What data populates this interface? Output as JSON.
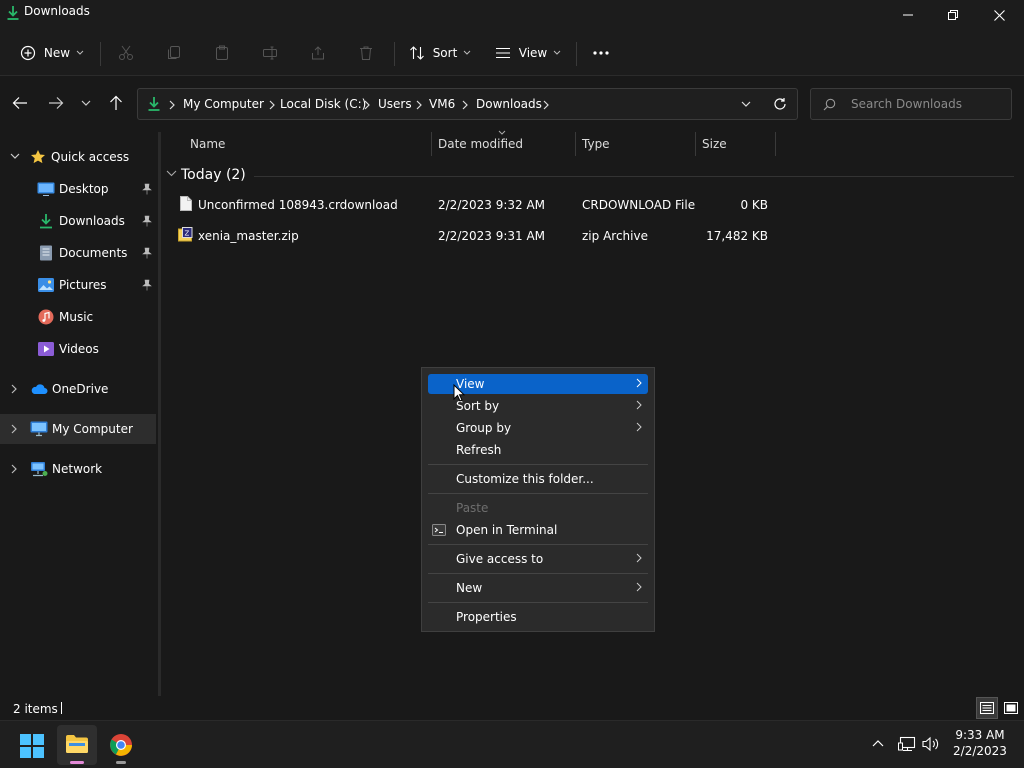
{
  "window": {
    "title": "Downloads",
    "controls": [
      "minimize-icon",
      "restore-icon",
      "close-icon"
    ]
  },
  "toolbar": {
    "new_label": "New",
    "sort_label": "Sort",
    "view_label": "View",
    "icons": [
      "cut-icon",
      "copy-icon",
      "paste-icon",
      "rename-icon",
      "share-icon",
      "delete-icon",
      "more-icon"
    ]
  },
  "address": {
    "breadcrumbs": [
      "My Computer",
      "Local Disk (C:)",
      "Users",
      "VM6",
      "Downloads"
    ],
    "search_placeholder": "Search Downloads"
  },
  "nav": {
    "quick_access": "Quick access",
    "items": [
      {
        "label": "Desktop",
        "icon": "desktop-icon",
        "pinned": true
      },
      {
        "label": "Downloads",
        "icon": "download-icon",
        "pinned": true
      },
      {
        "label": "Documents",
        "icon": "documents-icon",
        "pinned": true
      },
      {
        "label": "Pictures",
        "icon": "pictures-icon",
        "pinned": true
      },
      {
        "label": "Music",
        "icon": "music-icon",
        "pinned": false
      },
      {
        "label": "Videos",
        "icon": "videos-icon",
        "pinned": false
      }
    ],
    "onedrive": "OneDrive",
    "my_computer": "My Computer",
    "network": "Network"
  },
  "files": {
    "columns": [
      "Name",
      "Date modified",
      "Type",
      "Size"
    ],
    "group_label": "Today (2)",
    "rows": [
      {
        "name": "Unconfirmed 108943.crdownload",
        "date": "2/2/2023 9:32 AM",
        "type": "CRDOWNLOAD File",
        "size": "0 KB"
      },
      {
        "name": "xenia_master.zip",
        "date": "2/2/2023 9:31 AM",
        "type": "zip Archive",
        "size": "17,482 KB"
      }
    ]
  },
  "context_menu": {
    "items": [
      {
        "label": "View",
        "submenu": true,
        "highlighted": true
      },
      {
        "label": "Sort by",
        "submenu": true
      },
      {
        "label": "Group by",
        "submenu": true
      },
      {
        "label": "Refresh",
        "submenu": false
      },
      {
        "label": "Customize this folder...",
        "submenu": false
      },
      {
        "label": "Paste",
        "submenu": false,
        "disabled": true
      },
      {
        "label": "Open in Terminal",
        "submenu": false
      },
      {
        "label": "Give access to",
        "submenu": true
      },
      {
        "label": "New",
        "submenu": true
      },
      {
        "label": "Properties",
        "submenu": false
      }
    ]
  },
  "status": {
    "items_count": "2 items"
  },
  "taskbar": {
    "time": "9:33 AM",
    "date": "2/2/2023"
  },
  "colors": {
    "accent": "#0a63c9",
    "download_green": "#29b86a",
    "folder_yellow": "#f4c542"
  }
}
